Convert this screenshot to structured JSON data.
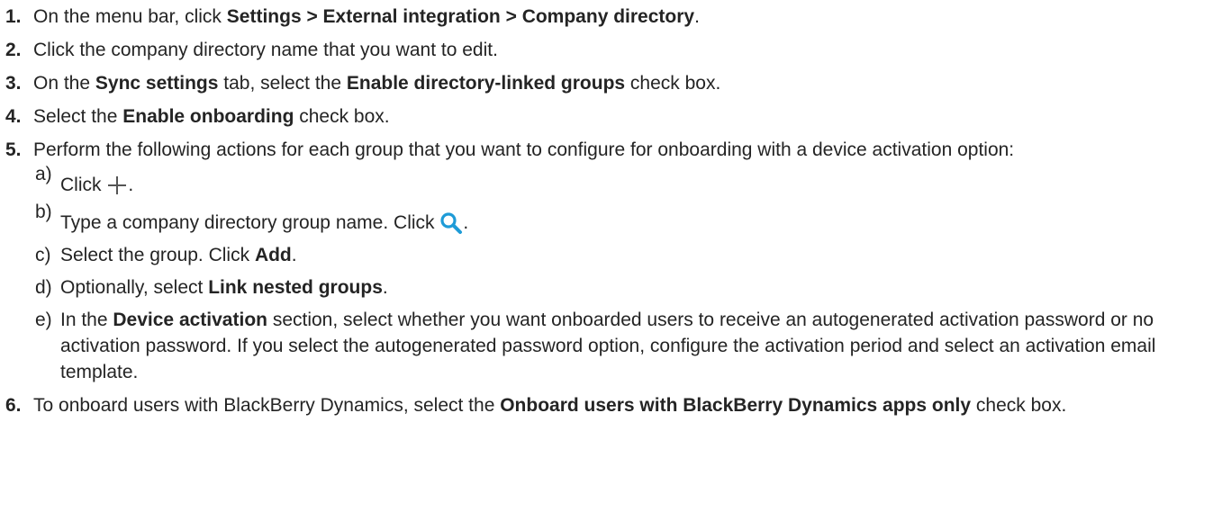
{
  "steps": [
    {
      "num": "1.",
      "parts": [
        "On the menu bar, click ",
        "Settings > External integration > Company directory",
        "."
      ]
    },
    {
      "num": "2.",
      "text": "Click the company directory name that you want to edit."
    },
    {
      "num": "3.",
      "parts": [
        "On the ",
        "Sync settings",
        " tab, select the ",
        "Enable directory-linked groups",
        " check box."
      ]
    },
    {
      "num": "4.",
      "parts": [
        "Select the ",
        "Enable onboarding",
        " check box."
      ]
    },
    {
      "num": "5.",
      "text": "Perform the following actions for each group that you want to configure for onboarding with a device activation option:",
      "substeps": [
        {
          "letter": "a)",
          "before": "Click ",
          "icon": "plus-icon",
          "after": "."
        },
        {
          "letter": "b)",
          "before": "Type a company directory group name. Click ",
          "icon": "search-icon",
          "after": "."
        },
        {
          "letter": "c)",
          "parts": [
            "Select the group. Click ",
            "Add",
            "."
          ]
        },
        {
          "letter": "d)",
          "parts": [
            "Optionally, select ",
            "Link nested groups",
            "."
          ]
        },
        {
          "letter": "e)",
          "parts": [
            "In the ",
            "Device activation",
            " section, select whether you want onboarded users to receive an autogenerated activation password or no activation password. If you select the autogenerated password option, configure the activation period and select an activation email template."
          ]
        }
      ]
    },
    {
      "num": "6.",
      "parts": [
        "To onboard users with BlackBerry Dynamics, select the ",
        "Onboard users with BlackBerry Dynamics apps only",
        " check box."
      ]
    }
  ],
  "colors": {
    "text": "#242424",
    "plus_icon": "#555555",
    "search_icon": "#1e9bd7"
  }
}
